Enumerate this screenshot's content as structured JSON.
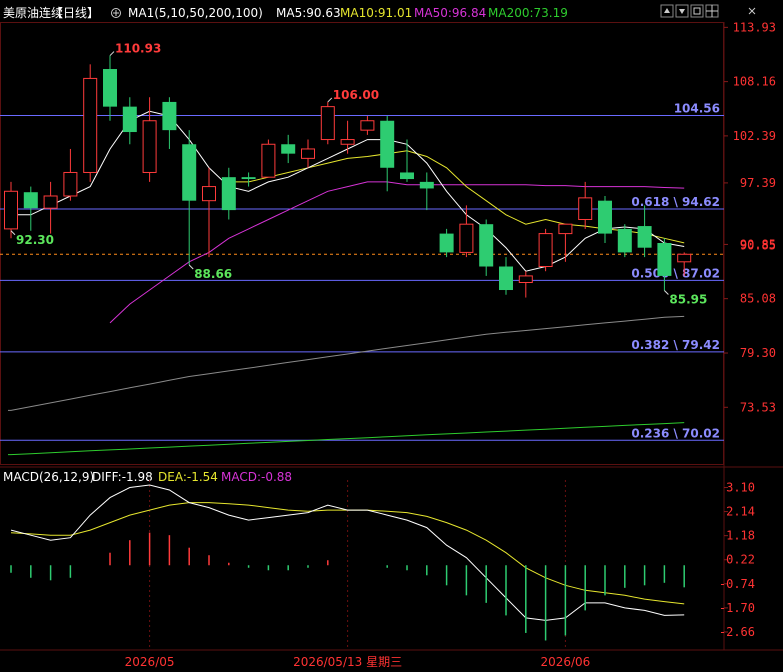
{
  "header": {
    "instrument": "美原油连续",
    "period": "【日线】",
    "ma_title": "MA1(5,10,50,200,100)",
    "ma5": "MA5:90.63",
    "ma10": "MA10:91.01",
    "ma50": "MA50:96.84",
    "ma200": "MA200:73.19",
    "icons": [
      "plus-circle-icon",
      "up-arrow-icon",
      "down-arrow-icon",
      "window-icon",
      "grid-icon",
      "close-icon"
    ]
  },
  "macd_header": {
    "title": "MACD(26,12,9)",
    "diff": "DIFF:-1.98",
    "dea": "DEA:-1.54",
    "macd": "MACD:-0.88"
  },
  "colors": {
    "up": "#ff3b3b",
    "down": "#2ecc71",
    "ma5": "#ffffff",
    "ma10": "#e6e62e",
    "ma50": "#d633d6",
    "ma200": "#2ecc2e",
    "ma100": "#8a8a8a",
    "fib": "#6a6aff",
    "last_price": "#ff8c1a",
    "high_label": "#ff3b3b",
    "low_label": "#5ce65c"
  },
  "chart_data": {
    "type": "candlestick",
    "price_axis": {
      "min": 67.5,
      "max": 114.5,
      "ticks": [
        "113.93",
        "108.16",
        "102.39",
        "97.39",
        "90.85",
        "85.08",
        "79.30",
        "73.53"
      ]
    },
    "candles": [
      {
        "o": 92.5,
        "h": 97.5,
        "l": 91.5,
        "c": 96.5
      },
      {
        "o": 96.4,
        "h": 97.0,
        "l": 92.3,
        "c": 94.7
      },
      {
        "o": 94.7,
        "h": 97.5,
        "l": 92.0,
        "c": 96.0
      },
      {
        "o": 96.0,
        "h": 101.0,
        "l": 95.5,
        "c": 98.5
      },
      {
        "o": 98.5,
        "h": 110.0,
        "l": 97.5,
        "c": 108.5
      },
      {
        "o": 109.5,
        "h": 110.93,
        "l": 104.0,
        "c": 105.5
      },
      {
        "o": 105.5,
        "h": 106.5,
        "l": 101.5,
        "c": 102.8
      },
      {
        "o": 98.5,
        "h": 106.5,
        "l": 97.5,
        "c": 104.0
      },
      {
        "o": 106.0,
        "h": 106.5,
        "l": 101.0,
        "c": 103.0
      },
      {
        "o": 101.5,
        "h": 103.0,
        "l": 88.66,
        "c": 95.5
      },
      {
        "o": 95.5,
        "h": 99.0,
        "l": 89.5,
        "c": 97.0
      },
      {
        "o": 98.0,
        "h": 99.0,
        "l": 93.5,
        "c": 94.5
      },
      {
        "o": 98.0,
        "h": 98.5,
        "l": 97.0,
        "c": 97.8
      },
      {
        "o": 98.0,
        "h": 102.0,
        "l": 98.0,
        "c": 101.5
      },
      {
        "o": 101.5,
        "h": 102.5,
        "l": 99.5,
        "c": 100.5
      },
      {
        "o": 100.0,
        "h": 102.0,
        "l": 99.0,
        "c": 101.0
      },
      {
        "o": 102.0,
        "h": 106.0,
        "l": 101.5,
        "c": 105.5
      },
      {
        "o": 101.5,
        "h": 104.0,
        "l": 100.5,
        "c": 102.0
      },
      {
        "o": 103.0,
        "h": 104.5,
        "l": 102.5,
        "c": 104.0
      },
      {
        "o": 104.0,
        "h": 104.5,
        "l": 96.5,
        "c": 99.0
      },
      {
        "o": 98.5,
        "h": 102.0,
        "l": 97.5,
        "c": 97.8
      },
      {
        "o": 97.5,
        "h": 98.5,
        "l": 94.5,
        "c": 96.8
      },
      {
        "o": 92.0,
        "h": 92.5,
        "l": 89.5,
        "c": 90.0
      },
      {
        "o": 90.0,
        "h": 95.0,
        "l": 89.5,
        "c": 93.0
      },
      {
        "o": 93.0,
        "h": 93.5,
        "l": 87.5,
        "c": 88.5
      },
      {
        "o": 88.5,
        "h": 89.5,
        "l": 85.5,
        "c": 86.0
      },
      {
        "o": 86.8,
        "h": 88.0,
        "l": 85.2,
        "c": 87.5
      },
      {
        "o": 88.5,
        "h": 92.5,
        "l": 88.0,
        "c": 92.0
      },
      {
        "o": 92.0,
        "h": 93.0,
        "l": 89.0,
        "c": 93.0
      },
      {
        "o": 93.5,
        "h": 97.5,
        "l": 92.5,
        "c": 95.8
      },
      {
        "o": 95.5,
        "h": 96.0,
        "l": 91.0,
        "c": 92.0
      },
      {
        "o": 92.5,
        "h": 93.0,
        "l": 89.5,
        "c": 90.0
      },
      {
        "o": 92.8,
        "h": 95.0,
        "l": 89.5,
        "c": 90.5
      },
      {
        "o": 91.0,
        "h": 91.5,
        "l": 85.95,
        "c": 87.5
      },
      {
        "o": 89.0,
        "h": 90.0,
        "l": 87.5,
        "c": 89.8
      }
    ],
    "ma5": [
      94.0,
      94.0,
      95.0,
      96.0,
      97.0,
      101.0,
      104.0,
      105.0,
      104.5,
      102.0,
      99.0,
      97.0,
      96.5,
      97.5,
      98.0,
      99.0,
      100.0,
      101.0,
      102.0,
      102.0,
      101.5,
      99.5,
      96.5,
      94.0,
      92.5,
      90.5,
      88.0,
      88.5,
      89.5,
      91.5,
      92.5,
      92.7,
      92.5,
      91.0,
      90.63
    ],
    "ma10": [
      null,
      null,
      null,
      null,
      null,
      null,
      null,
      null,
      null,
      null,
      null,
      97.5,
      97.5,
      98.0,
      98.5,
      99.0,
      99.5,
      100.0,
      100.2,
      100.5,
      100.8,
      100.2,
      99.0,
      97.0,
      95.5,
      94.0,
      93.0,
      93.5,
      93.0,
      92.8,
      92.5,
      92.3,
      92.0,
      91.5,
      91.01
    ],
    "ma50": [
      null,
      null,
      null,
      null,
      null,
      82.5,
      84.5,
      86.0,
      87.5,
      89.0,
      90.0,
      91.5,
      92.5,
      93.5,
      94.5,
      95.5,
      96.5,
      97.0,
      97.5,
      97.5,
      97.2,
      97.2,
      97.2,
      97.2,
      97.2,
      97.2,
      97.2,
      97.1,
      97.1,
      97.0,
      97.0,
      97.0,
      97.0,
      96.9,
      96.84
    ],
    "ma100": [
      73.2,
      73.6,
      74.0,
      74.4,
      74.8,
      75.2,
      75.6,
      76.0,
      76.4,
      76.8,
      77.1,
      77.4,
      77.7,
      78.0,
      78.3,
      78.6,
      78.9,
      79.2,
      79.5,
      79.8,
      80.1,
      80.4,
      80.7,
      81.0,
      81.3,
      81.5,
      81.7,
      81.9,
      82.1,
      82.3,
      82.5,
      82.7,
      82.9,
      83.1,
      83.2
    ],
    "ma200": [
      68.5,
      68.6,
      68.7,
      68.8,
      68.9,
      69.0,
      69.1,
      69.2,
      69.3,
      69.4,
      69.5,
      69.6,
      69.7,
      69.8,
      69.9,
      70.0,
      70.1,
      70.2,
      70.3,
      70.4,
      70.5,
      70.6,
      70.7,
      70.8,
      70.9,
      71.0,
      71.1,
      71.2,
      71.3,
      71.4,
      71.5,
      71.6,
      71.7,
      71.8,
      71.9
    ],
    "horizontal_lines": [
      {
        "value": 104.56,
        "label": "104.56"
      },
      {
        "value": 94.62,
        "label": "0.618 \\ 94.62"
      },
      {
        "value": 87.02,
        "label": "0.500 \\ 87.02"
      },
      {
        "value": 79.42,
        "label": "0.382 \\ 79.42"
      },
      {
        "value": 70.02,
        "label": "0.236 \\ 70.02"
      }
    ],
    "last_price": {
      "value": 89.8,
      "label": "90.85"
    },
    "annotations": [
      {
        "text": "110.93",
        "candle": 5,
        "value": 110.93,
        "kind": "high"
      },
      {
        "text": "106.00",
        "candle": 16,
        "value": 106.0,
        "kind": "high"
      },
      {
        "text": "88.66",
        "candle": 9,
        "value": 88.66,
        "kind": "low"
      },
      {
        "text": "92.30",
        "candle": 0,
        "value": 92.3,
        "kind": "low"
      },
      {
        "text": "85.95",
        "candle": 33,
        "value": 85.95,
        "kind": "low"
      }
    ],
    "macd": {
      "axis": {
        "min": -3.3,
        "max": 3.4,
        "ticks": [
          "3.10",
          "2.14",
          "1.18",
          "0.22",
          "-0.74",
          "-1.70",
          "-2.66"
        ]
      },
      "diff": [
        1.4,
        1.2,
        1.0,
        1.1,
        2.0,
        2.7,
        3.1,
        3.2,
        3.0,
        2.5,
        2.3,
        2.0,
        1.8,
        1.9,
        2.0,
        2.1,
        2.4,
        2.2,
        2.2,
        2.0,
        1.8,
        1.5,
        0.8,
        0.3,
        -0.5,
        -1.3,
        -2.1,
        -2.2,
        -2.1,
        -1.5,
        -1.5,
        -1.7,
        -1.8,
        -2.0,
        -1.98
      ],
      "dea": [
        1.3,
        1.25,
        1.2,
        1.2,
        1.4,
        1.7,
        2.0,
        2.2,
        2.4,
        2.5,
        2.5,
        2.45,
        2.4,
        2.3,
        2.2,
        2.15,
        2.2,
        2.2,
        2.2,
        2.15,
        2.1,
        1.95,
        1.7,
        1.4,
        1.0,
        0.5,
        -0.1,
        -0.5,
        -0.8,
        -1.0,
        -1.1,
        -1.2,
        -1.35,
        -1.45,
        -1.54
      ],
      "hist": [
        -0.3,
        -0.5,
        -0.6,
        -0.5,
        0.0,
        0.5,
        1.0,
        1.3,
        1.2,
        0.7,
        0.4,
        0.1,
        -0.1,
        -0.2,
        -0.2,
        -0.1,
        0.2,
        0.0,
        0.0,
        -0.1,
        -0.2,
        -0.4,
        -0.8,
        -1.2,
        -1.5,
        -2.0,
        -2.7,
        -3.0,
        -2.8,
        -1.8,
        -1.2,
        -0.9,
        -0.8,
        -0.7,
        -0.88
      ]
    },
    "x_labels": [
      {
        "text": "2026/05",
        "candle": 7
      },
      {
        "text": "2026/05/13 星期三",
        "candle": 17
      },
      {
        "text": "2026/06",
        "candle": 28
      }
    ]
  }
}
